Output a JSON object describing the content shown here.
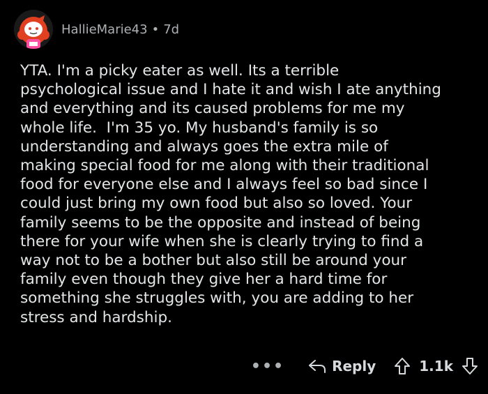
{
  "comment": {
    "username": "HallieMarie43",
    "separator": "•",
    "age": "7d",
    "body": "YTA. I'm a picky eater as well. Its a terrible\npsychological issue and I hate it and wish I ate anything\nand everything and its caused problems for me my\nwhole life.  I'm 35 yo. My husband's family is so\nunderstanding and always goes the extra mile of\nmaking special food for me along with their traditional\nfood for everyone else and I always feel so bad since I\ncould just bring my own food but also so loved. Your\nfamily seems to be the opposite and instead of being\nthere for your wife when she is clearly trying to find a\nway not to be a bother but also still be around your\nfamily even though they give her a hard time for\nsomething she struggles with, you are adding to her\nstress and hardship."
  },
  "actions": {
    "more": "•••",
    "reply_label": "Reply",
    "score": "1.1k"
  },
  "icons": {
    "avatar": "snoo-avatar-red-hair",
    "reply": "reply-arrow-icon",
    "upvote": "upvote-arrow-icon",
    "downvote": "downvote-arrow-icon"
  },
  "colors": {
    "background": "#000000",
    "text": "#e3e5e6",
    "meta": "#adb0b3",
    "avatar_hair": "#e0401f"
  }
}
